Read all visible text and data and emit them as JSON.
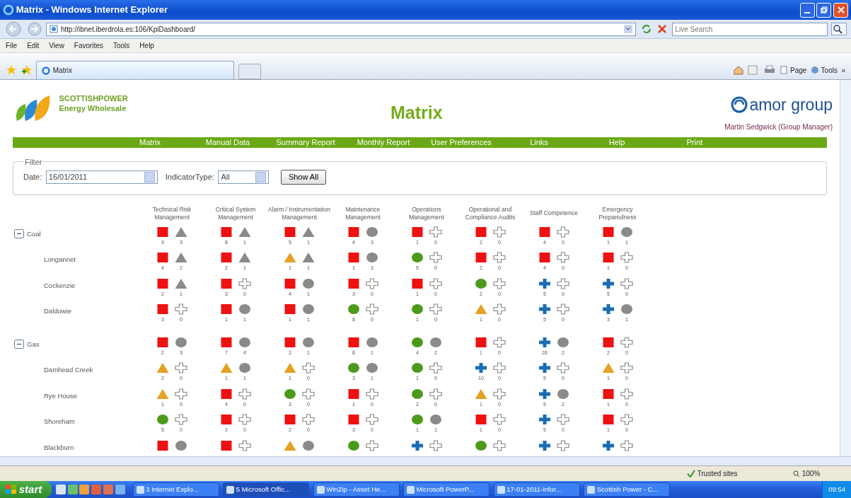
{
  "window": {
    "title": "Matrix - Windows Internet Explorer"
  },
  "address_bar": {
    "url": "http://ibnet.iberdrola.es:106/KpiDashboard/",
    "search_placeholder": "Live Search"
  },
  "menu": [
    "File",
    "Edit",
    "View",
    "Favorites",
    "Tools",
    "Help"
  ],
  "tabs": [
    {
      "label": "Matrix",
      "selected": true
    }
  ],
  "command_bar": {
    "page": "Page",
    "tools": "Tools",
    "more": "»"
  },
  "page": {
    "brand_name": "SCOTTISHPOWER",
    "brand_division": "Energy Wholesale",
    "title": "Matrix",
    "partner": "amor group",
    "user": "Martin Sedgwick (Group Manager)",
    "nav": [
      "Matrix",
      "Manual Data",
      "Summary Report",
      "Monthly Report",
      "User Preferences",
      "Links",
      "Help",
      "Print"
    ],
    "filter": {
      "legend": "Filter",
      "date_label": "Date:",
      "date": "16/01/2011",
      "type_label": "IndicatorType:",
      "type": "All",
      "button": "Show All"
    },
    "columns": [
      "Technical Risk Management",
      "Critical System Management",
      "Alarm / Instrumentation Management",
      "Maintenance Management",
      "Operations Management",
      "Operational and Compliance Audits",
      "Staff Competence",
      "Emergency Preparedness"
    ],
    "groups": [
      {
        "label": "Coal",
        "expanded": true,
        "cells": [
          [
            {
              "kind": "square",
              "color": "#ee1111",
              "count": "9"
            },
            {
              "kind": "triangle",
              "color": "#8a8a8a",
              "count": "3"
            }
          ],
          [
            {
              "kind": "square",
              "color": "#ee1111",
              "count": "8"
            },
            {
              "kind": "triangle",
              "color": "#8a8a8a",
              "count": "1"
            }
          ],
          [
            {
              "kind": "square",
              "color": "#ee1111",
              "count": "5"
            },
            {
              "kind": "triangle",
              "color": "#8a8a8a",
              "count": "1"
            }
          ],
          [
            {
              "kind": "square",
              "color": "#ee1111",
              "count": "4"
            },
            {
              "kind": "circle",
              "color": "#8a8a8a",
              "count": "3"
            }
          ],
          [
            {
              "kind": "square",
              "color": "#ee1111",
              "count": "1"
            },
            {
              "kind": "outline",
              "color": "#ffffff",
              "count": "0"
            }
          ],
          [
            {
              "kind": "square",
              "color": "#ee1111",
              "count": "2"
            },
            {
              "kind": "outline",
              "color": "#ffffff",
              "count": "0"
            }
          ],
          [
            {
              "kind": "square",
              "color": "#ee1111",
              "count": "4"
            },
            {
              "kind": "outline",
              "color": "#ffffff",
              "count": "0"
            }
          ],
          [
            {
              "kind": "square",
              "color": "#ee1111",
              "count": "1"
            },
            {
              "kind": "circle",
              "color": "#8a8a8a",
              "count": "1"
            }
          ]
        ],
        "children": [
          {
            "label": "Longannet",
            "cells": [
              [
                {
                  "kind": "square",
                  "color": "#ee1111",
                  "count": "4"
                },
                {
                  "kind": "triangle",
                  "color": "#8a8a8a",
                  "count": "2"
                }
              ],
              [
                {
                  "kind": "square",
                  "color": "#ee1111",
                  "count": "2"
                },
                {
                  "kind": "triangle",
                  "color": "#8a8a8a",
                  "count": "1"
                }
              ],
              [
                {
                  "kind": "triangle",
                  "color": "#e6a023",
                  "count": "1"
                },
                {
                  "kind": "triangle",
                  "color": "#8a8a8a",
                  "count": "1"
                }
              ],
              [
                {
                  "kind": "square",
                  "color": "#ee1111",
                  "count": "1"
                },
                {
                  "kind": "circle",
                  "color": "#8a8a8a",
                  "count": "3"
                }
              ],
              [
                {
                  "kind": "circle",
                  "color": "#4c9a1c",
                  "count": "5"
                },
                {
                  "kind": "outline",
                  "color": "#ffffff",
                  "count": "0"
                }
              ],
              [
                {
                  "kind": "square",
                  "color": "#ee1111",
                  "count": "2"
                },
                {
                  "kind": "outline",
                  "color": "#ffffff",
                  "count": "0"
                }
              ],
              [
                {
                  "kind": "square",
                  "color": "#ee1111",
                  "count": "4"
                },
                {
                  "kind": "outline",
                  "color": "#ffffff",
                  "count": "0"
                }
              ],
              [
                {
                  "kind": "square",
                  "color": "#ee1111",
                  "count": "1"
                },
                {
                  "kind": "outline",
                  "color": "#ffffff",
                  "count": "0"
                }
              ]
            ]
          },
          {
            "label": "Cockenzie",
            "cells": [
              [
                {
                  "kind": "square",
                  "color": "#ee1111",
                  "count": "2"
                },
                {
                  "kind": "triangle",
                  "color": "#8a8a8a",
                  "count": "1"
                }
              ],
              [
                {
                  "kind": "square",
                  "color": "#ee1111",
                  "count": "3"
                },
                {
                  "kind": "outline",
                  "color": "#ffffff",
                  "count": "0"
                }
              ],
              [
                {
                  "kind": "square",
                  "color": "#ee1111",
                  "count": "4"
                },
                {
                  "kind": "circle",
                  "color": "#8a8a8a",
                  "count": "1"
                }
              ],
              [
                {
                  "kind": "square",
                  "color": "#ee1111",
                  "count": "3"
                },
                {
                  "kind": "outline",
                  "color": "#ffffff",
                  "count": "0"
                }
              ],
              [
                {
                  "kind": "square",
                  "color": "#ee1111",
                  "count": "1"
                },
                {
                  "kind": "outline",
                  "color": "#ffffff",
                  "count": "0"
                }
              ],
              [
                {
                  "kind": "circle",
                  "color": "#4c9a1c",
                  "count": "2"
                },
                {
                  "kind": "outline",
                  "color": "#ffffff",
                  "count": "0"
                }
              ],
              [
                {
                  "kind": "cross",
                  "color": "#1a6db3",
                  "count": "5"
                },
                {
                  "kind": "outline",
                  "color": "#ffffff",
                  "count": "0"
                }
              ],
              [
                {
                  "kind": "cross",
                  "color": "#1a6db3",
                  "count": "5"
                },
                {
                  "kind": "outline",
                  "color": "#ffffff",
                  "count": "0"
                }
              ]
            ]
          },
          {
            "label": "Daldowie",
            "cells": [
              [
                {
                  "kind": "square",
                  "color": "#ee1111",
                  "count": "3"
                },
                {
                  "kind": "outline",
                  "color": "#ffffff",
                  "count": "0"
                }
              ],
              [
                {
                  "kind": "square",
                  "color": "#ee1111",
                  "count": "1"
                },
                {
                  "kind": "circle",
                  "color": "#8a8a8a",
                  "count": "1"
                }
              ],
              [
                {
                  "kind": "square",
                  "color": "#ee1111",
                  "count": "1"
                },
                {
                  "kind": "circle",
                  "color": "#8a8a8a",
                  "count": "1"
                }
              ],
              [
                {
                  "kind": "circle",
                  "color": "#4c9a1c",
                  "count": "8"
                },
                {
                  "kind": "outline",
                  "color": "#ffffff",
                  "count": "0"
                }
              ],
              [
                {
                  "kind": "circle",
                  "color": "#4c9a1c",
                  "count": "1"
                },
                {
                  "kind": "outline",
                  "color": "#ffffff",
                  "count": "0"
                }
              ],
              [
                {
                  "kind": "triangle",
                  "color": "#e6a023",
                  "count": "1"
                },
                {
                  "kind": "outline",
                  "color": "#ffffff",
                  "count": "0"
                }
              ],
              [
                {
                  "kind": "cross",
                  "color": "#1a6db3",
                  "count": "5"
                },
                {
                  "kind": "outline",
                  "color": "#ffffff",
                  "count": "0"
                }
              ],
              [
                {
                  "kind": "cross",
                  "color": "#1a6db3",
                  "count": "3"
                },
                {
                  "kind": "circle",
                  "color": "#8a8a8a",
                  "count": "1"
                }
              ]
            ]
          }
        ]
      },
      {
        "label": "Gas",
        "expanded": true,
        "cells": [
          [
            {
              "kind": "square",
              "color": "#ee1111",
              "count": "2"
            },
            {
              "kind": "circle",
              "color": "#8a8a8a",
              "count": "3"
            }
          ],
          [
            {
              "kind": "square",
              "color": "#ee1111",
              "count": "7"
            },
            {
              "kind": "circle",
              "color": "#8a8a8a",
              "count": "4"
            }
          ],
          [
            {
              "kind": "square",
              "color": "#ee1111",
              "count": "2"
            },
            {
              "kind": "circle",
              "color": "#8a8a8a",
              "count": "1"
            }
          ],
          [
            {
              "kind": "square",
              "color": "#ee1111",
              "count": "8"
            },
            {
              "kind": "circle",
              "color": "#8a8a8a",
              "count": "1"
            }
          ],
          [
            {
              "kind": "circle",
              "color": "#4c9a1c",
              "count": "4"
            },
            {
              "kind": "circle",
              "color": "#8a8a8a",
              "count": "2"
            }
          ],
          [
            {
              "kind": "square",
              "color": "#ee1111",
              "count": "1"
            },
            {
              "kind": "outline",
              "color": "#ffffff",
              "count": "0"
            }
          ],
          [
            {
              "kind": "cross",
              "color": "#1a6db3",
              "count": "26"
            },
            {
              "kind": "circle",
              "color": "#8a8a8a",
              "count": "2"
            }
          ],
          [
            {
              "kind": "square",
              "color": "#ee1111",
              "count": "2"
            },
            {
              "kind": "outline",
              "color": "#ffffff",
              "count": "0"
            }
          ]
        ],
        "children": [
          {
            "label": "Damhead Creek",
            "cells": [
              [
                {
                  "kind": "triangle",
                  "color": "#e6a023",
                  "count": "2"
                },
                {
                  "kind": "outline",
                  "color": "#ffffff",
                  "count": "0"
                }
              ],
              [
                {
                  "kind": "triangle",
                  "color": "#e6a023",
                  "count": "1"
                },
                {
                  "kind": "circle",
                  "color": "#8a8a8a",
                  "count": "1"
                }
              ],
              [
                {
                  "kind": "triangle",
                  "color": "#e6a023",
                  "count": "1"
                },
                {
                  "kind": "outline",
                  "color": "#ffffff",
                  "count": "0"
                }
              ],
              [
                {
                  "kind": "circle",
                  "color": "#4c9a1c",
                  "count": "3"
                },
                {
                  "kind": "circle",
                  "color": "#8a8a8a",
                  "count": "1"
                }
              ],
              [
                {
                  "kind": "circle",
                  "color": "#4c9a1c",
                  "count": "1"
                },
                {
                  "kind": "outline",
                  "color": "#ffffff",
                  "count": "0"
                }
              ],
              [
                {
                  "kind": "cross",
                  "color": "#1a6db3",
                  "count": "10"
                },
                {
                  "kind": "outline",
                  "color": "#ffffff",
                  "count": "0"
                }
              ],
              [
                {
                  "kind": "cross",
                  "color": "#1a6db3",
                  "count": "5"
                },
                {
                  "kind": "outline",
                  "color": "#ffffff",
                  "count": "0"
                }
              ],
              [
                {
                  "kind": "triangle",
                  "color": "#e6a023",
                  "count": "1"
                },
                {
                  "kind": "outline",
                  "color": "#ffffff",
                  "count": "0"
                }
              ]
            ]
          },
          {
            "label": "Rye House",
            "cells": [
              [
                {
                  "kind": "triangle",
                  "color": "#e6a023",
                  "count": "1"
                },
                {
                  "kind": "outline",
                  "color": "#ffffff",
                  "count": "0"
                }
              ],
              [
                {
                  "kind": "square",
                  "color": "#ee1111",
                  "count": "4"
                },
                {
                  "kind": "outline",
                  "color": "#ffffff",
                  "count": "0"
                }
              ],
              [
                {
                  "kind": "circle",
                  "color": "#4c9a1c",
                  "count": "3"
                },
                {
                  "kind": "outline",
                  "color": "#ffffff",
                  "count": "0"
                }
              ],
              [
                {
                  "kind": "square",
                  "color": "#ee1111",
                  "count": "1"
                },
                {
                  "kind": "outline",
                  "color": "#ffffff",
                  "count": "0"
                }
              ],
              [
                {
                  "kind": "circle",
                  "color": "#4c9a1c",
                  "count": "2"
                },
                {
                  "kind": "outline",
                  "color": "#ffffff",
                  "count": "0"
                }
              ],
              [
                {
                  "kind": "triangle",
                  "color": "#e6a023",
                  "count": "1"
                },
                {
                  "kind": "outline",
                  "color": "#ffffff",
                  "count": "0"
                }
              ],
              [
                {
                  "kind": "cross",
                  "color": "#1a6db3",
                  "count": "5"
                },
                {
                  "kind": "circle",
                  "color": "#8a8a8a",
                  "count": "2"
                }
              ],
              [
                {
                  "kind": "square",
                  "color": "#ee1111",
                  "count": "1"
                },
                {
                  "kind": "outline",
                  "color": "#ffffff",
                  "count": "0"
                }
              ]
            ]
          },
          {
            "label": "Shoreham",
            "cells": [
              [
                {
                  "kind": "circle",
                  "color": "#4c9a1c",
                  "count": "5"
                },
                {
                  "kind": "outline",
                  "color": "#ffffff",
                  "count": "0"
                }
              ],
              [
                {
                  "kind": "square",
                  "color": "#ee1111",
                  "count": "2"
                },
                {
                  "kind": "outline",
                  "color": "#ffffff",
                  "count": "0"
                }
              ],
              [
                {
                  "kind": "square",
                  "color": "#ee1111",
                  "count": "2"
                },
                {
                  "kind": "outline",
                  "color": "#ffffff",
                  "count": "0"
                }
              ],
              [
                {
                  "kind": "square",
                  "color": "#ee1111",
                  "count": "3"
                },
                {
                  "kind": "outline",
                  "color": "#ffffff",
                  "count": "0"
                }
              ],
              [
                {
                  "kind": "circle",
                  "color": "#4c9a1c",
                  "count": "1"
                },
                {
                  "kind": "circle",
                  "color": "#8a8a8a",
                  "count": "1"
                }
              ],
              [
                {
                  "kind": "square",
                  "color": "#ee1111",
                  "count": "1"
                },
                {
                  "kind": "outline",
                  "color": "#ffffff",
                  "count": "0"
                }
              ],
              [
                {
                  "kind": "cross",
                  "color": "#1a6db3",
                  "count": "5"
                },
                {
                  "kind": "outline",
                  "color": "#ffffff",
                  "count": "0"
                }
              ],
              [
                {
                  "kind": "square",
                  "color": "#ee1111",
                  "count": "1"
                },
                {
                  "kind": "outline",
                  "color": "#ffffff",
                  "count": "0"
                }
              ]
            ]
          },
          {
            "label": "Blackburn",
            "cells": [
              [
                {
                  "kind": "square",
                  "color": "#ee1111"
                },
                {
                  "kind": "circle",
                  "color": "#8a8a8a"
                }
              ],
              [
                {
                  "kind": "square",
                  "color": "#ee1111"
                },
                {
                  "kind": "outline",
                  "color": "#ffffff"
                }
              ],
              [
                {
                  "kind": "triangle",
                  "color": "#e6a023"
                },
                {
                  "kind": "circle",
                  "color": "#8a8a8a"
                }
              ],
              [
                {
                  "kind": "circle",
                  "color": "#4c9a1c"
                },
                {
                  "kind": "outline",
                  "color": "#ffffff"
                }
              ],
              [
                {
                  "kind": "cross",
                  "color": "#1a6db3"
                },
                {
                  "kind": "outline",
                  "color": "#ffffff"
                }
              ],
              [
                {
                  "kind": "circle",
                  "color": "#4c9a1c"
                },
                {
                  "kind": "outline",
                  "color": "#ffffff"
                }
              ],
              [
                {
                  "kind": "cross",
                  "color": "#1a6db3"
                },
                {
                  "kind": "outline",
                  "color": "#ffffff"
                }
              ],
              [
                {
                  "kind": "cross",
                  "color": "#1a6db3"
                },
                {
                  "kind": "outline",
                  "color": "#ffffff"
                }
              ]
            ]
          }
        ]
      }
    ]
  },
  "status_bar": {
    "zone": "Trusted sites",
    "zoom": "100%"
  },
  "taskbar": {
    "start": "start",
    "tasks": [
      "3 Internet Explo...",
      "5 Microsoft Offic...",
      "WinZip - Asset He...",
      "Microsoft PowerP...",
      "17-01-2011-infor...",
      "Scottish Power - C..."
    ],
    "clock": "09:54"
  }
}
